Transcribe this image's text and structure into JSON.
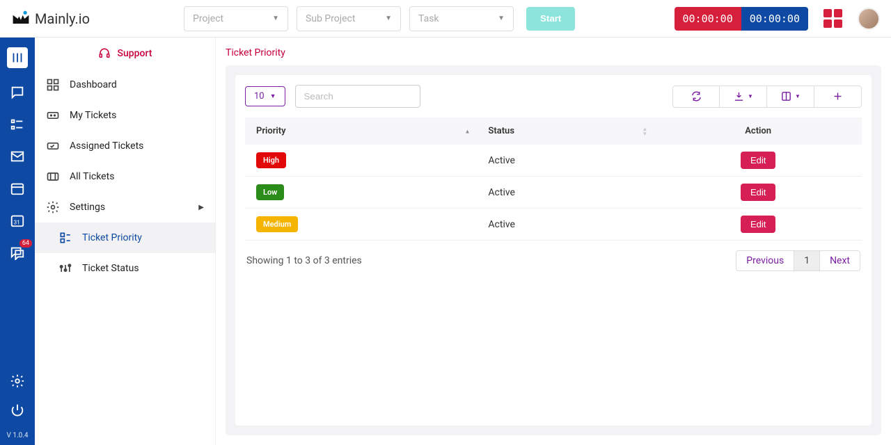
{
  "header": {
    "logo_text": "Mainly.io",
    "selects": {
      "project": "Project",
      "sub_project": "Sub Project",
      "task": "Task"
    },
    "start_label": "Start",
    "timer1": "00:00:00",
    "timer2": "00:00:00"
  },
  "rail": {
    "badge_chat": "64",
    "version": "V 1.0.4"
  },
  "sidebar": {
    "title": "Support",
    "items": [
      {
        "label": "Dashboard"
      },
      {
        "label": "My Tickets"
      },
      {
        "label": "Assigned Tickets"
      },
      {
        "label": "All Tickets"
      },
      {
        "label": "Settings"
      }
    ],
    "settings_children": [
      {
        "label": "Ticket Priority"
      },
      {
        "label": "Ticket Status"
      }
    ]
  },
  "page": {
    "title": "Ticket Priority",
    "page_size": "10",
    "search_placeholder": "Search",
    "columns": {
      "priority": "Priority",
      "status": "Status",
      "action": "Action"
    },
    "rows": [
      {
        "priority": "High",
        "status": "Active",
        "action": "Edit",
        "color": "high"
      },
      {
        "priority": "Low",
        "status": "Active",
        "action": "Edit",
        "color": "low"
      },
      {
        "priority": "Medium",
        "status": "Active",
        "action": "Edit",
        "color": "medium"
      }
    ],
    "footer_text": "Showing 1 to 3 of 3 entries",
    "pager": {
      "prev": "Previous",
      "page": "1",
      "next": "Next"
    }
  }
}
